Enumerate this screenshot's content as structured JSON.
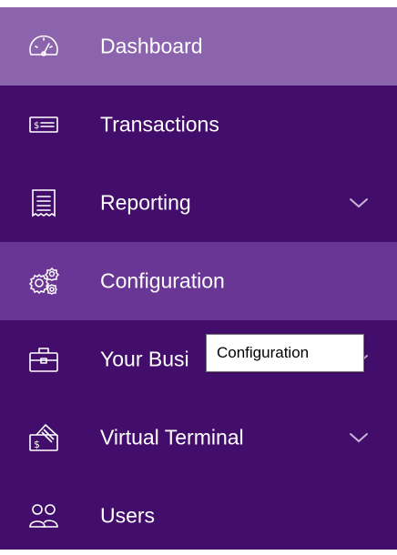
{
  "nav": {
    "items": [
      {
        "label": "Dashboard",
        "icon": "gauge-icon",
        "has_chevron": false,
        "state": "active"
      },
      {
        "label": "Transactions",
        "icon": "bill-icon",
        "has_chevron": false,
        "state": "normal"
      },
      {
        "label": "Reporting",
        "icon": "receipt-icon",
        "has_chevron": true,
        "state": "normal"
      },
      {
        "label": "Configuration",
        "icon": "gears-icon",
        "has_chevron": false,
        "state": "hover"
      },
      {
        "label": "Your Busi",
        "icon": "briefcase-icon",
        "has_chevron": true,
        "state": "normal"
      },
      {
        "label": "Virtual Terminal",
        "icon": "card-terminal-icon",
        "has_chevron": true,
        "state": "normal"
      },
      {
        "label": "Users",
        "icon": "users-icon",
        "has_chevron": false,
        "state": "normal"
      }
    ]
  },
  "tooltip": {
    "text": "Configuration"
  },
  "colors": {
    "sidebar_bg": "#430e6b",
    "active_bg": "#8c64ad",
    "hover_bg": "#6a3695",
    "text": "#ffffff",
    "chevron": "#c9b3da"
  }
}
